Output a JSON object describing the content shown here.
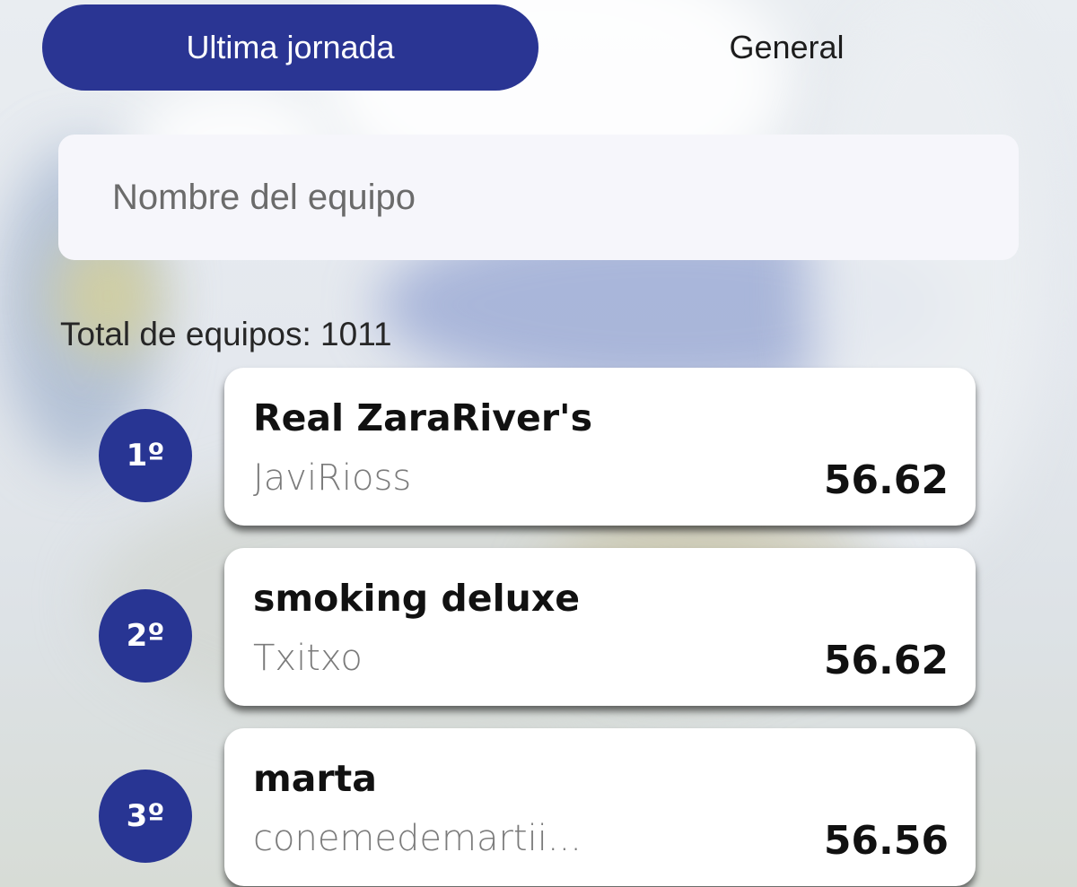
{
  "tabs": [
    {
      "label": "Ultima jornada",
      "active": true
    },
    {
      "label": "General",
      "active": false
    }
  ],
  "search": {
    "placeholder": "Nombre del equipo",
    "value": ""
  },
  "total": {
    "text": "Total de equipos: 1011"
  },
  "ranking": [
    {
      "position": "1º",
      "team": "Real ZaraRiver's",
      "manager": "JaviRioss",
      "points": "56.62"
    },
    {
      "position": "2º",
      "team": "smoking deluxe",
      "manager": "Txitxo",
      "points": "56.62"
    },
    {
      "position": "3º",
      "team": "marta",
      "manager": "conemedemartii...",
      "points": "56.56"
    }
  ],
  "colors": {
    "accent": "#2a3593",
    "badge": "#283593",
    "card": "#ffffff",
    "search_bg": "#f6f6fb"
  }
}
